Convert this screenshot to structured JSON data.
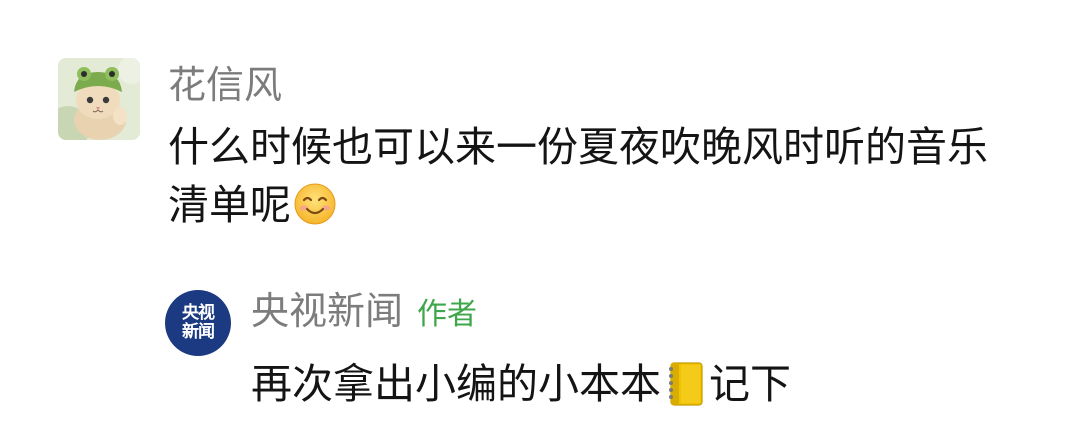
{
  "comment": {
    "avatar_icon": "cat-avatar-icon",
    "user_name": "花信风",
    "text_line1": "什么时候也可以来一份夏夜吹晚风时听的音乐",
    "text_line2": "清单呢",
    "emoji": "smiling-face-emoji"
  },
  "reply": {
    "avatar_line1": "央视",
    "avatar_line2": "新闻",
    "user_name": "央视新闻",
    "author_tag": "作者",
    "text_part1": "再次拿出小编的小本本",
    "emoji": "notebook-emoji",
    "text_part2": "记下"
  },
  "colors": {
    "name_gray": "#7c7c7c",
    "text_black": "#141414",
    "author_green": "#3fa64a",
    "cctv_blue": "#1c3a82"
  }
}
